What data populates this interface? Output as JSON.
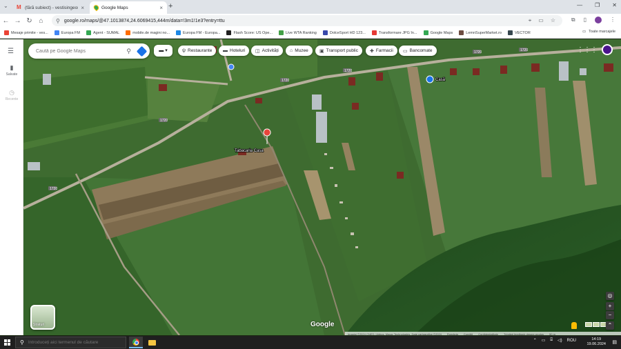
{
  "browser": {
    "tabs": [
      {
        "title": "(fără subiect) - vestisingeorz...",
        "icon": "gmail-icon",
        "active": false
      },
      {
        "title": "Google Maps",
        "icon": "maps-icon",
        "active": true
      }
    ],
    "url": "google.ro/maps/@47.1013874,24.6069415,444m/data=!3m1!1e3?entry=ttu",
    "bookmarks": [
      {
        "label": "Mesaje primite - ves...",
        "color": "#ea4335"
      },
      {
        "label": "Europa FM",
        "color": "#4285f4"
      },
      {
        "label": "Agent - SUMAL",
        "color": "#34a853"
      },
      {
        "label": "mobile.de magini no...",
        "color": "#ff6d00"
      },
      {
        "label": "Europa FM - Europa...",
        "color": "#1e88e5"
      },
      {
        "label": "Flash Score: US Ope...",
        "color": "#212121"
      },
      {
        "label": "Live WTA Ranking",
        "color": "#43a047"
      },
      {
        "label": "DolceSport HD 123...",
        "color": "#3949ab"
      },
      {
        "label": "Transformare JPG în...",
        "color": "#e53935"
      },
      {
        "label": "Google Maps",
        "color": "#34a853"
      },
      {
        "label": "LemnSuperMarket.ro",
        "color": "#6d4c41"
      },
      {
        "label": "VECTOR",
        "color": "#37474f"
      }
    ],
    "bookmarks_end": "Toate marcajele"
  },
  "maps": {
    "search_placeholder": "Caută pe Google Maps",
    "rail": {
      "saved": "Salvate",
      "recent": "Recente"
    },
    "chips": [
      {
        "label": "Restaurante",
        "icon": "fork-knife-icon"
      },
      {
        "label": "Hoteluri",
        "icon": "bed-icon"
      },
      {
        "label": "Activități",
        "icon": "ticket-icon"
      },
      {
        "label": "Muzee",
        "icon": "museum-icon"
      },
      {
        "label": "Transport public",
        "icon": "bus-icon"
      },
      {
        "label": "Farmacii",
        "icon": "pharmacy-icon"
      },
      {
        "label": "Bancomate",
        "icon": "atm-icon"
      }
    ],
    "layers_label": "Straturi",
    "road_number": "1720",
    "places": {
      "house": "Casă",
      "shop": "Tabacaria Casa"
    },
    "logo": "Google",
    "attribution": [
      "Imagini ©2024 CNES / Airbus, Maxar Technologies, Date cartografice ©2024",
      "România",
      "Condiții",
      "Confidențialitate",
      "Trimiteți feedback despre produs",
      "50 m"
    ]
  },
  "taskbar": {
    "search_placeholder": "Introduceți aici termenul de căutare",
    "language": "ROU",
    "time": "14:19",
    "date": "19.06.2024"
  }
}
